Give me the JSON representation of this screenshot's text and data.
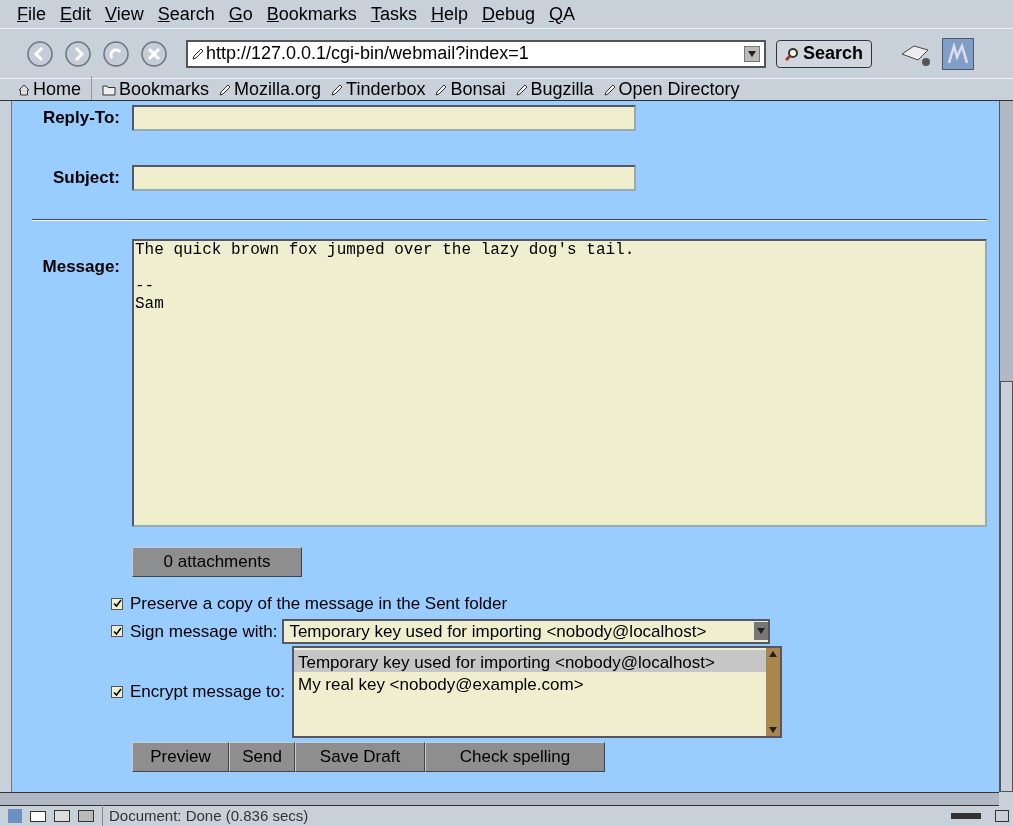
{
  "menu": [
    "File",
    "Edit",
    "View",
    "Search",
    "Go",
    "Bookmarks",
    "Tasks",
    "Help",
    "Debug",
    "QA"
  ],
  "url": "http://127.0.0.1/cgi-bin/webmail?index=1",
  "search_button": "Search",
  "bookmarks": [
    {
      "kind": "home",
      "label": "Home"
    },
    {
      "kind": "folder",
      "label": "Bookmarks"
    },
    {
      "kind": "link",
      "label": "Mozilla.org"
    },
    {
      "kind": "link",
      "label": "Tinderbox"
    },
    {
      "kind": "link",
      "label": "Bonsai"
    },
    {
      "kind": "link",
      "label": "Bugzilla"
    },
    {
      "kind": "link",
      "label": "Open Directory"
    }
  ],
  "form": {
    "reply_to": {
      "label": "Reply-To:"
    },
    "subject": {
      "label": "Subject:"
    },
    "message": {
      "label": "Message:",
      "value": "The quick brown fox jumped over the lazy dog's tail.\n\n--\nSam"
    },
    "attachments_button": "0 attachments",
    "options": [
      {
        "kind": "plain",
        "label": "Preserve a copy of the message in the Sent folder",
        "checked": true
      },
      {
        "kind": "select",
        "label": "Sign message with:",
        "checked": true,
        "value": "Temporary key used for importing <nobody@localhost>"
      },
      {
        "kind": "list",
        "label": "Encrypt message to:",
        "checked": true,
        "items": [
          {
            "label": "Temporary key used for importing <nobody@localhost>",
            "selected": true
          },
          {
            "label": "My real key <nobody@example.com>",
            "selected": false
          }
        ]
      }
    ],
    "buttons": [
      "Preview",
      "Send",
      "Save Draft",
      "Check spelling"
    ]
  },
  "status": "Document: Done (0.836 secs)"
}
